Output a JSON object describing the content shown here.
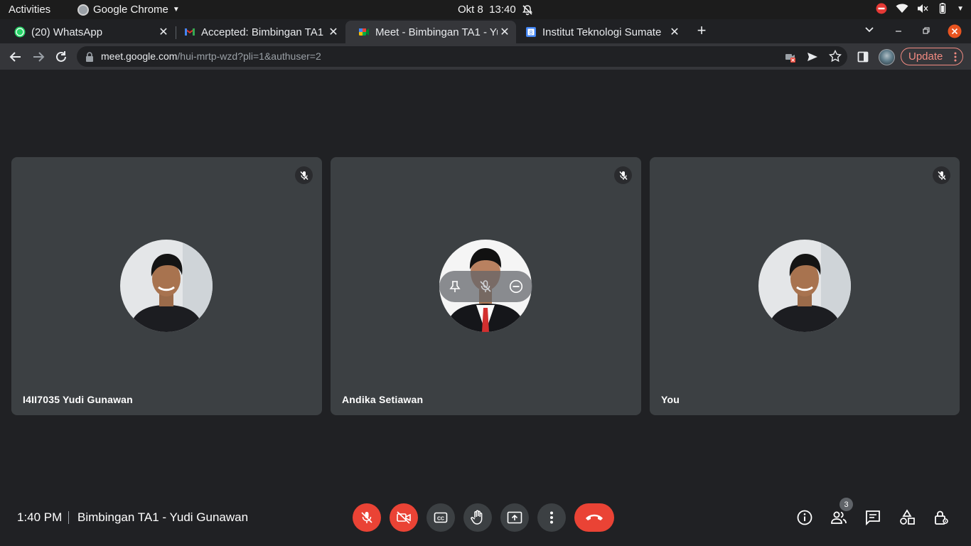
{
  "system": {
    "activities_label": "Activities",
    "app_name": "Google Chrome",
    "clock": "Okt 8  13:40"
  },
  "browser": {
    "tabs": [
      {
        "label": "(20) WhatsApp",
        "favicon": "whatsapp-icon"
      },
      {
        "label": "Accepted: Bimbingan TA1",
        "favicon": "gmail-icon"
      },
      {
        "label": "Meet - Bimbingan TA1 - Yu",
        "favicon": "meet-icon",
        "active": true
      },
      {
        "label": "Institut Teknologi Sumate",
        "favicon": "calendar-icon"
      }
    ],
    "url_host": "meet.google.com",
    "url_path": "/hui-mrtp-wzd?pli=1&authuser=2",
    "update_label": "Update",
    "calendar_day": "8"
  },
  "meeting": {
    "participants": [
      {
        "name": "I4II7035 Yudi Gunawan",
        "muted": true
      },
      {
        "name": "Andika Setiawan",
        "muted": true
      },
      {
        "name": "You",
        "muted": true
      }
    ],
    "time": "1:40 PM",
    "title": "Bimbingan TA1 - Yudi Gunawan",
    "people_count": "3"
  },
  "colors": {
    "background": "#202124",
    "tile": "#3c4043",
    "danger": "#ea4335",
    "update_accent": "#f28b82"
  }
}
